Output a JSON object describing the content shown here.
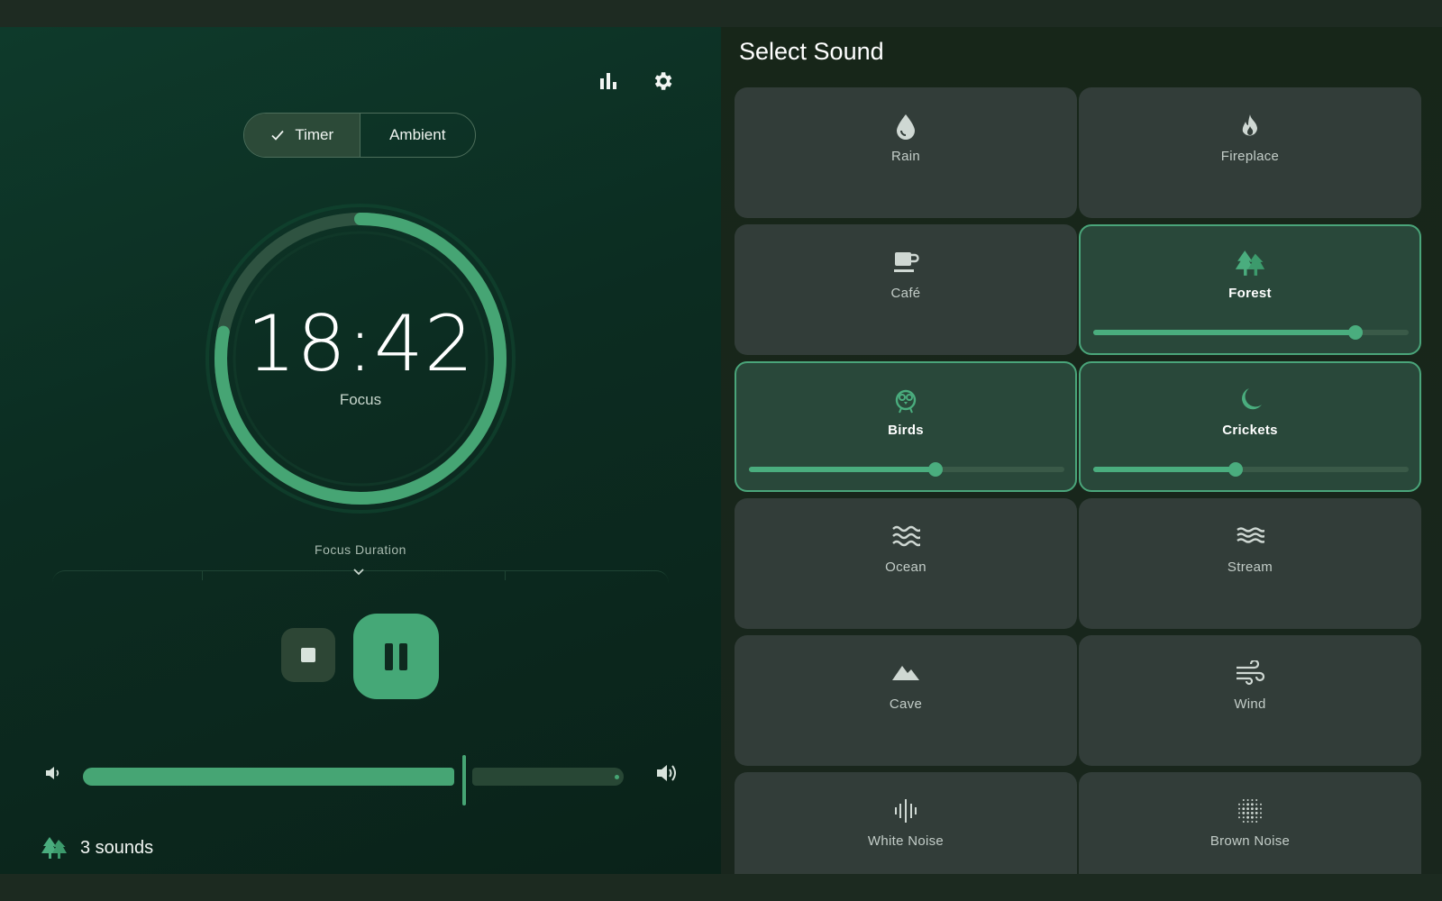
{
  "header": {
    "stats_icon": "bar-chart-icon",
    "settings_icon": "gear-icon"
  },
  "mode_toggle": {
    "options": [
      {
        "label": "Timer",
        "selected": true
      },
      {
        "label": "Ambient",
        "selected": false
      }
    ]
  },
  "timer": {
    "time": "18:42",
    "label": "Focus",
    "progress": 0.78
  },
  "duration": {
    "label": "Focus Duration"
  },
  "controls": {
    "stop_icon": "stop-icon",
    "pause_icon": "pause-icon"
  },
  "volume": {
    "level": 0.7,
    "low_icon": "volume-low-icon",
    "high_icon": "volume-high-icon"
  },
  "footer": {
    "sounds_count": "3 sounds",
    "icon": "forest-icon"
  },
  "sound_panel": {
    "title": "Select Sound",
    "sounds": [
      {
        "label": "Rain",
        "icon": "water-drop-icon",
        "active": false
      },
      {
        "label": "Fireplace",
        "icon": "fire-icon",
        "active": false
      },
      {
        "label": "Café",
        "icon": "coffee-cup-icon",
        "active": false
      },
      {
        "label": "Forest",
        "icon": "forest-icon",
        "active": true,
        "volume": 0.83
      },
      {
        "label": "Birds",
        "icon": "bird-icon",
        "active": true,
        "volume": 0.59
      },
      {
        "label": "Crickets",
        "icon": "moon-icon",
        "active": true,
        "volume": 0.45
      },
      {
        "label": "Ocean",
        "icon": "waves-icon",
        "active": false
      },
      {
        "label": "Stream",
        "icon": "stream-icon",
        "active": false
      },
      {
        "label": "Cave",
        "icon": "mountain-icon",
        "active": false
      },
      {
        "label": "Wind",
        "icon": "wind-icon",
        "active": false
      },
      {
        "label": "White Noise",
        "icon": "sound-wave-icon",
        "active": false
      },
      {
        "label": "Brown Noise",
        "icon": "noise-dots-icon",
        "active": false
      }
    ]
  },
  "colors": {
    "accent": "#46a574",
    "accent_dark": "#29483a",
    "tile_bg": "#323d39"
  }
}
